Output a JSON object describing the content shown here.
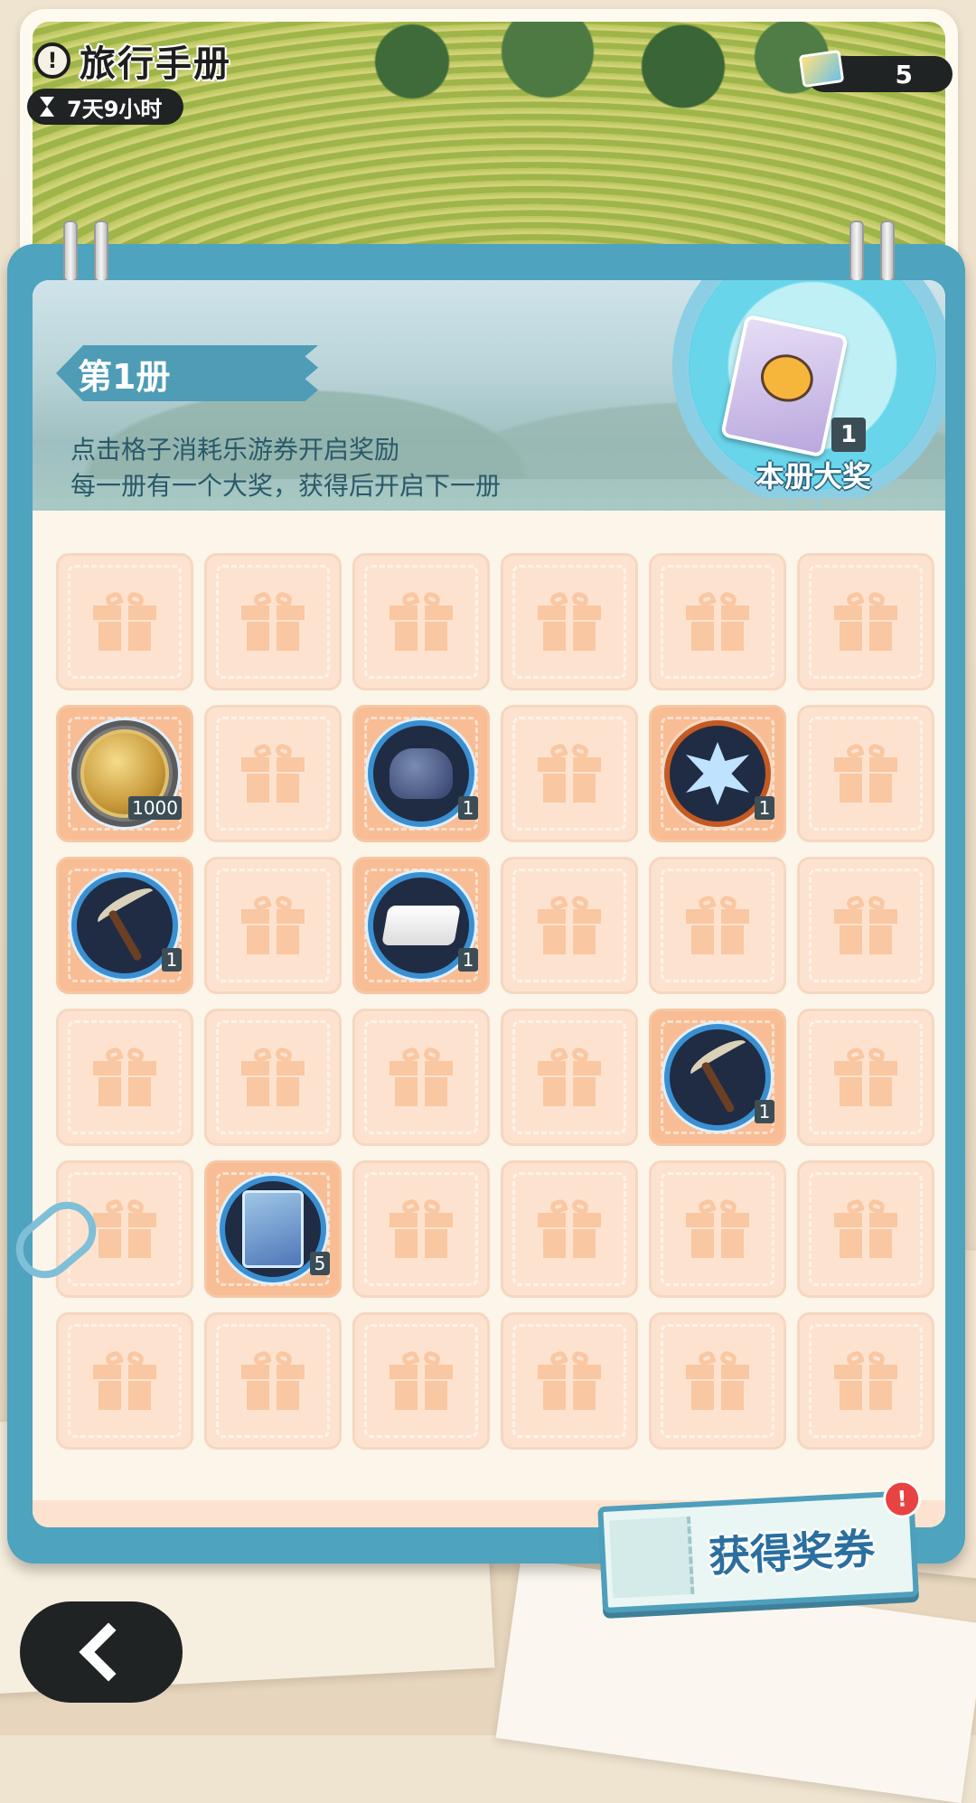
{
  "header": {
    "title": "旅行手册",
    "timer": "7天9小时",
    "ticket_count": "5"
  },
  "volume": {
    "tag": "第1册",
    "desc_line1": "点击格子消耗乐游券开启奖励",
    "desc_line2": "每一册有一个大奖，获得后开启下一册"
  },
  "grand_prize": {
    "label": "本册大奖",
    "count": "1"
  },
  "grid": [
    [
      "gift",
      "gift",
      "gift",
      "gift",
      "gift",
      "gift"
    ],
    [
      "coin:1000",
      "gift",
      "glove:1",
      "gift",
      "crystal:1",
      "gift"
    ],
    [
      "pickaxe:1",
      "gift",
      "towel:1",
      "gift",
      "gift",
      "gift"
    ],
    [
      "gift",
      "gift",
      "gift",
      "gift",
      "pickaxe:1",
      "gift"
    ],
    [
      "gift",
      "card:5",
      "gift",
      "gift",
      "gift",
      "gift"
    ],
    [
      "gift",
      "gift",
      "gift",
      "gift",
      "gift",
      "gift"
    ]
  ],
  "actions": {
    "get_vouchers": "获得奖券",
    "alert": "!"
  },
  "icons": {
    "back": "back-arrow-icon",
    "warn": "info-icon",
    "timer": "hourglass-icon",
    "ticket": "ticket-icon"
  }
}
